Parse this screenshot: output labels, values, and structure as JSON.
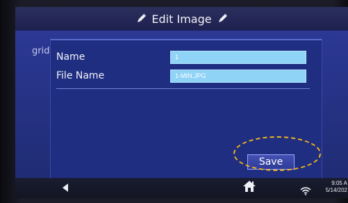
{
  "titlebar": {
    "title": "Edit Image",
    "left_icon": "pencil-icon",
    "right_icon": "pencil-icon"
  },
  "sidebar": {
    "label": "grid"
  },
  "form": {
    "fields": [
      {
        "label": "Name",
        "value": "1"
      },
      {
        "label": "File Name",
        "value": "1-MIN.JPG"
      }
    ],
    "save_label": "Save"
  },
  "bottombar": {
    "back_icon": "back-arrow-icon",
    "home_icon": "home-icon",
    "wifi_icon": "wifi-icon",
    "time": "9:05 A",
    "date": "5/14/202"
  },
  "colors": {
    "screen_bg": "#2a3690",
    "panel_bg": "#1f2e80",
    "input_bg": "#8fd3f6",
    "save_highlight": "#f2b61b",
    "titlebar_bg": "#232654"
  }
}
